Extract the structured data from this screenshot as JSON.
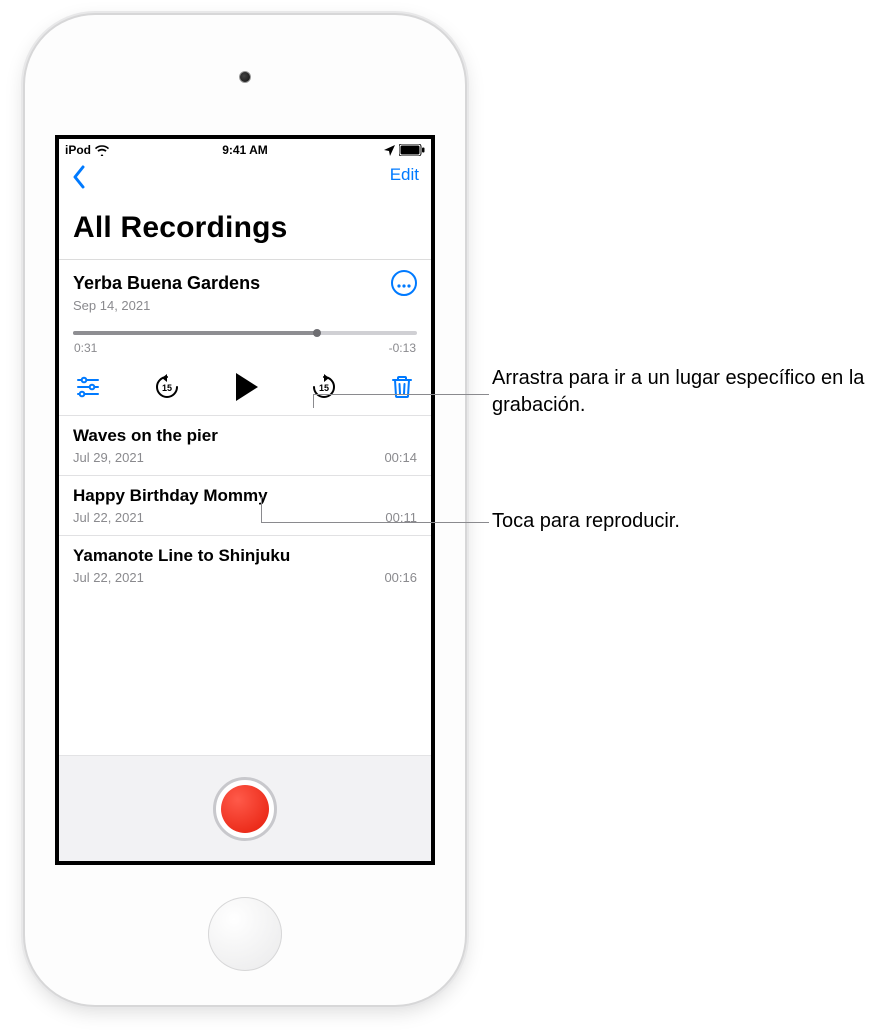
{
  "status": {
    "carrier": "iPod",
    "time": "9:41 AM"
  },
  "navbar": {
    "edit_label": "Edit"
  },
  "title": "All Recordings",
  "selected": {
    "title": "Yerba Buena Gardens",
    "date": "Sep 14, 2021",
    "elapsed": "0:31",
    "remaining": "-0:13",
    "scrub_progress_pct": 71,
    "skip_seconds": "15"
  },
  "recordings": [
    {
      "title": "Waves on the pier",
      "date": "Jul 29, 2021",
      "duration": "00:14"
    },
    {
      "title": "Happy Birthday Mommy",
      "date": "Jul 22, 2021",
      "duration": "00:11"
    },
    {
      "title": "Yamanote Line to Shinjuku",
      "date": "Jul 22, 2021",
      "duration": "00:16"
    }
  ],
  "callouts": {
    "scrub": "Arrastra para ir a un lugar específico en la grabación.",
    "play": "Toca para reproducir."
  },
  "colors": {
    "accent": "#007aff",
    "record": "#e51c0a"
  }
}
